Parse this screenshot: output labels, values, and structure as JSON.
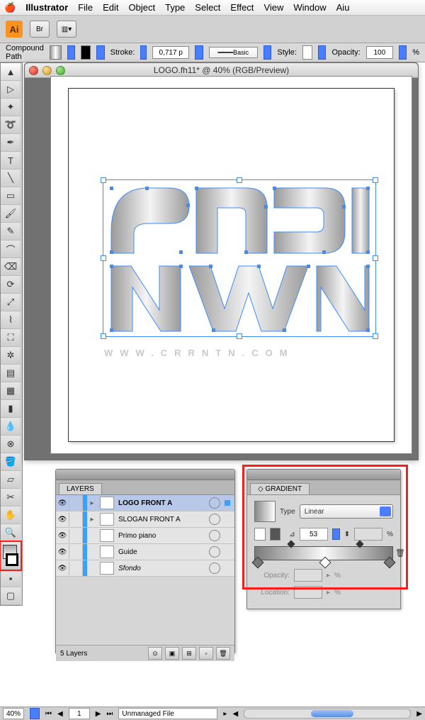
{
  "menubar": {
    "app": "Illustrator",
    "items": [
      "File",
      "Edit",
      "Object",
      "Type",
      "Select",
      "Effect",
      "View",
      "Window",
      "Aiu"
    ]
  },
  "controlbar": {
    "path_type": "Compound Path",
    "stroke_label": "Stroke:",
    "stroke_value": "0,717 p",
    "stroke_style": "Basic",
    "style_label": "Style:",
    "opacity_label": "Opacity:",
    "opacity_value": "100",
    "opacity_unit": "%"
  },
  "document": {
    "title": "LOGO.fh11* @ 40% (RGB/Preview)",
    "url_text": "WWW.CRRNTN.COM"
  },
  "layers_panel": {
    "title": "LAYERS",
    "rows": [
      {
        "name": "LOGO FRONT A",
        "selected": true,
        "expandable": true,
        "bold": true
      },
      {
        "name": "SLOGAN FRONT A",
        "selected": false,
        "expandable": true,
        "bold": false
      },
      {
        "name": "Primo piano",
        "selected": false,
        "expandable": false,
        "bold": false
      },
      {
        "name": "Guide",
        "selected": false,
        "expandable": false,
        "bold": false
      },
      {
        "name": "Sfondo",
        "selected": false,
        "expandable": false,
        "bold": false
      }
    ],
    "footer": "5 Layers"
  },
  "gradient_panel": {
    "title": "GRADIENT",
    "type_label": "Type",
    "type_value": "Linear",
    "angle_value": "53",
    "opacity_label": "Opacity:",
    "opacity_unit": "%",
    "location_label": "Location:",
    "location_unit": "%"
  },
  "statusbar": {
    "zoom": "40%",
    "page": "1",
    "status": "Unmanaged File"
  },
  "tools": [
    "selection",
    "direct-selection",
    "magic-wand",
    "lasso",
    "pen",
    "type",
    "line",
    "rectangle",
    "paintbrush",
    "pencil",
    "blob",
    "eraser",
    "rotate",
    "scale",
    "warp",
    "free-transform",
    "symbol-sprayer",
    "graph",
    "mesh",
    "gradient",
    "eyedropper",
    "blend",
    "live-paint",
    "slice",
    "crop",
    "move",
    "hand",
    "zoom"
  ]
}
